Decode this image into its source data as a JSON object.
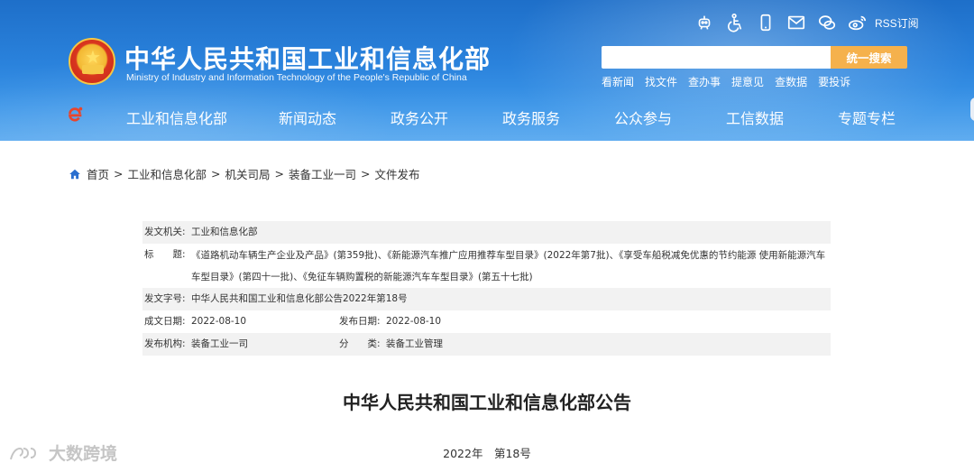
{
  "header": {
    "title": "中华人民共和国工业和信息化部",
    "subtitle": "Ministry of Industry and Information Technology of the People's Republic of China",
    "tool_icons": [
      "robot-icon",
      "accessibility-icon",
      "mobile-icon",
      "mail-icon",
      "wechat-icon",
      "weibo-icon"
    ],
    "rss_label": "RSS订阅",
    "search": {
      "placeholder": "",
      "button_label": "统一搜索"
    },
    "quick_links": [
      "看新闻",
      "找文件",
      "查办事",
      "提意见",
      "查数据",
      "要投诉"
    ],
    "nav": [
      "工业和信息化部",
      "新闻动态",
      "政务公开",
      "政务服务",
      "公众参与",
      "工信数据",
      "专题专栏"
    ]
  },
  "breadcrumb": [
    "首页",
    "工业和信息化部",
    "机关司局",
    "装备工业一司",
    "文件发布"
  ],
  "info": {
    "issuer_label": "发文机关:",
    "issuer": "工业和信息化部",
    "title_label": "标　　题:",
    "title": "《道路机动车辆生产企业及产品》(第359批)、《新能源汽车推广应用推荐车型目录》(2022年第7批)、《享受车船税减免优惠的节约能源 使用新能源汽车车型目录》(第四十一批)、《免征车辆购置税的新能源汽车车型目录》(第五十七批)",
    "doc_no_label": "发文字号:",
    "doc_no": "中华人民共和国工业和信息化部公告2022年第18号",
    "created_label": "成文日期:",
    "created": "2022-08-10",
    "published_label": "发布日期:",
    "published": "2022-08-10",
    "org_label": "发布机构:",
    "org": "装备工业一司",
    "category_label": "分　　类:",
    "category": "装备工业管理"
  },
  "document": {
    "title": "中华人民共和国工业和信息化部公告",
    "number": "2022年　第18号"
  },
  "watermark": "大数跨境",
  "colors": {
    "header_blue": "#2a82dc",
    "search_button": "#f5b14c",
    "home_icon": "#2a6fcf"
  }
}
